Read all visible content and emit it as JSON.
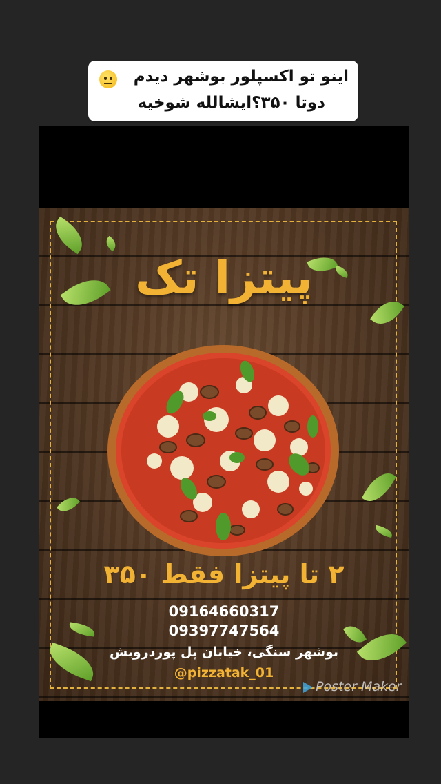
{
  "caption": {
    "line1": "اینو تو اکسپلور بوشهر دیدم",
    "line2": "دوتا ۳۵۰؟ایشالله شوخیه",
    "emoji": "neutral-face-icon"
  },
  "poster": {
    "title": "پیتزا تک",
    "offer": "۲ تا پیتزا فقط ۳۵۰",
    "phone1": "09164660317",
    "phone2": "09397747564",
    "address": "بوشهر  سنگی،  خیابان پل پوردرویش",
    "instagram": "@pizzatak_01",
    "watermark": "Poster Maker",
    "colors": {
      "accent": "#f2b233",
      "wood": "#4b3320",
      "leaf": "#7cc23e"
    }
  }
}
